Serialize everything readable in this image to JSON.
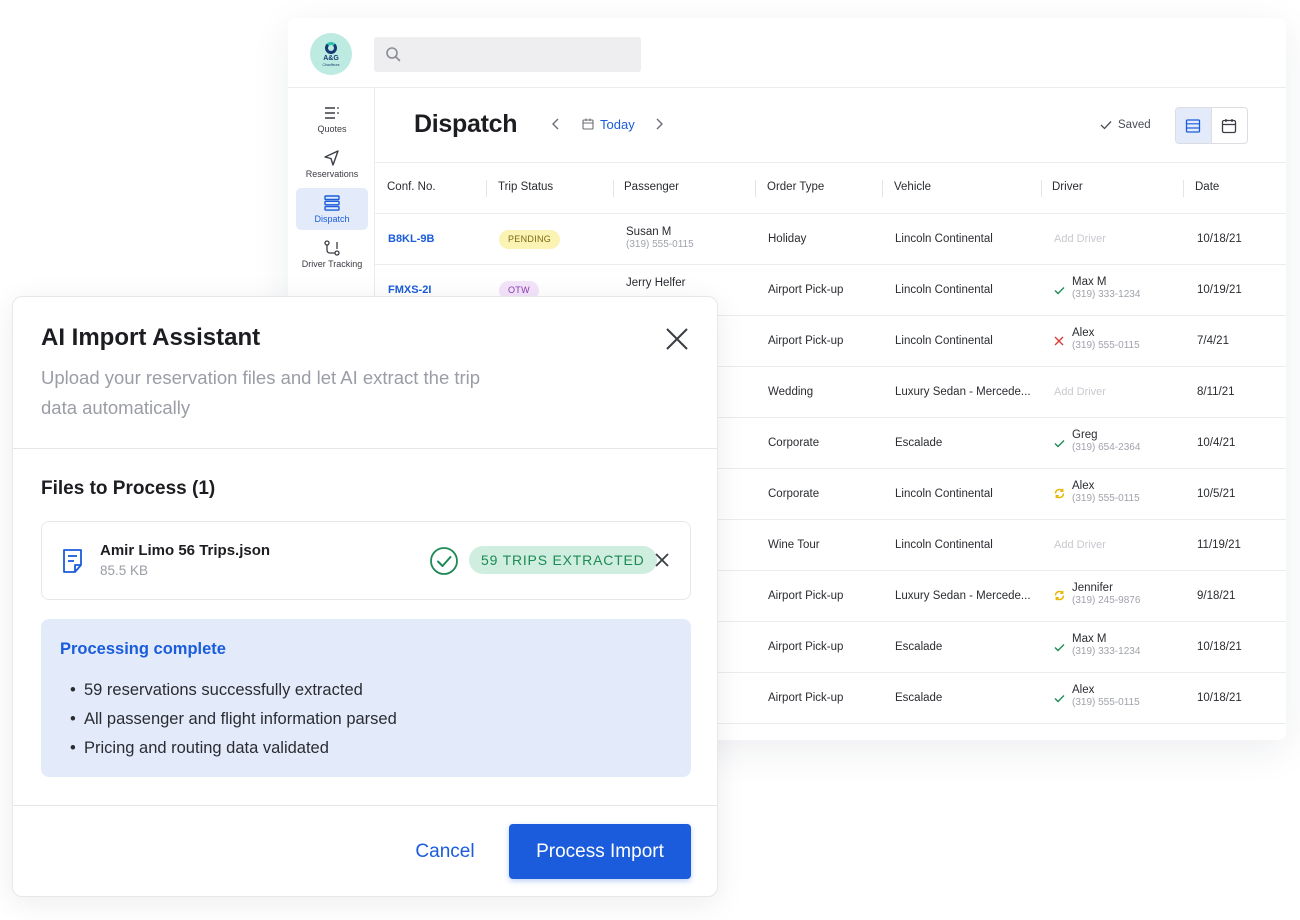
{
  "app": {
    "logo": {
      "text": "A&G",
      "subtext": "Chauffeurs"
    },
    "search": {
      "placeholder": ""
    },
    "sidebar": {
      "items": [
        {
          "label": "Quotes",
          "icon": "list-icon",
          "active": false
        },
        {
          "label": "Reservations",
          "icon": "navigation-arrow-icon",
          "active": false
        },
        {
          "label": "Dispatch",
          "icon": "stack-icon",
          "active": true
        },
        {
          "label": "Driver Tracking",
          "icon": "route-icon",
          "active": false
        }
      ]
    },
    "header": {
      "title": "Dispatch",
      "date_label": "Today",
      "saved_label": "Saved"
    },
    "table": {
      "columns": [
        "Conf. No.",
        "Trip Status",
        "Passenger",
        "Order Type",
        "Vehicle",
        "Driver",
        "Date"
      ],
      "rows": [
        {
          "conf": "B8KL-9B",
          "status": "PENDING",
          "passenger": "Susan M",
          "passenger_phone": "(319) 555-0115",
          "order_type": "Holiday",
          "vehicle": "Lincoln Continental",
          "driver": "",
          "driver_phone": "",
          "driver_status": "none",
          "add_driver": "Add Driver",
          "date": "10/18/21"
        },
        {
          "conf": "FMXS-2I",
          "status": "OTW",
          "passenger": "Jerry Helfer",
          "passenger_phone": "",
          "order_type": "Airport Pick-up",
          "vehicle": "Lincoln Continental",
          "driver": "Max M",
          "driver_phone": "(319) 333-1234",
          "driver_status": "confirmed",
          "add_driver": "",
          "date": "10/19/21"
        },
        {
          "conf": "",
          "status": "",
          "passenger": "",
          "passenger_phone": "",
          "order_type": "Airport Pick-up",
          "vehicle": "Lincoln Continental",
          "driver": "Alex",
          "driver_phone": "(319) 555-0115",
          "driver_status": "declined",
          "add_driver": "",
          "date": "7/4/21"
        },
        {
          "conf": "",
          "status": "",
          "passenger": "",
          "passenger_phone": "",
          "order_type": "Wedding",
          "vehicle": "Luxury Sedan - Mercede...",
          "driver": "",
          "driver_phone": "",
          "driver_status": "none",
          "add_driver": "Add Driver",
          "date": "8/11/21"
        },
        {
          "conf": "",
          "status": "",
          "passenger": "",
          "passenger_phone": "",
          "order_type": "Corporate",
          "vehicle": "Escalade",
          "driver": "Greg",
          "driver_phone": "(319) 654-2364",
          "driver_status": "confirmed",
          "add_driver": "",
          "date": "10/4/21"
        },
        {
          "conf": "",
          "status": "",
          "passenger": "",
          "passenger_phone": "",
          "order_type": "Corporate",
          "vehicle": "Lincoln Continental",
          "driver": "Alex",
          "driver_phone": "(319) 555-0115",
          "driver_status": "pending",
          "add_driver": "",
          "date": "10/5/21"
        },
        {
          "conf": "",
          "status": "",
          "passenger": "",
          "passenger_phone": "",
          "order_type": "Wine Tour",
          "vehicle": "Lincoln Continental",
          "driver": "",
          "driver_phone": "",
          "driver_status": "none",
          "add_driver": "Add Driver",
          "date": "11/19/21"
        },
        {
          "conf": "",
          "status": "",
          "passenger": "",
          "passenger_phone": "",
          "order_type": "Airport Pick-up",
          "vehicle": "Luxury Sedan - Mercede...",
          "driver": "Jennifer",
          "driver_phone": "(319) 245-9876",
          "driver_status": "pending",
          "add_driver": "",
          "date": "9/18/21"
        },
        {
          "conf": "",
          "status": "",
          "passenger": "",
          "passenger_phone": "",
          "order_type": "Airport Pick-up",
          "vehicle": "Escalade",
          "driver": "Max M",
          "driver_phone": "(319) 333-1234",
          "driver_status": "confirmed",
          "add_driver": "",
          "date": "10/18/21"
        },
        {
          "conf": "",
          "status": "",
          "passenger": "",
          "passenger_phone": "",
          "order_type": "Airport Pick-up",
          "vehicle": "Escalade",
          "driver": "Alex",
          "driver_phone": "(319) 555-0115",
          "driver_status": "confirmed",
          "add_driver": "",
          "date": "10/18/21"
        }
      ]
    }
  },
  "modal": {
    "title": "AI Import Assistant",
    "subtitle": "Upload your reservation files and let AI extract the trip data automatically",
    "files_heading": "Files to Process (1)",
    "file": {
      "name": "Amir Limo 56 Trips.json",
      "size": "85.5 KB",
      "status": "59 TRIPS EXTRACTED"
    },
    "processing": {
      "heading": "Processing complete",
      "items": [
        "59 reservations successfully extracted",
        "All passenger and flight information parsed",
        "Pricing and routing data validated"
      ]
    },
    "cancel_label": "Cancel",
    "primary_label": "Process Import"
  },
  "colors": {
    "accent": "#1a5cdb",
    "success": "#1d8a55",
    "pending_badge": "#fbf3b3",
    "otw_badge": "#f3e4fa",
    "declined": "#d93c3c",
    "warning": "#e8b400"
  }
}
